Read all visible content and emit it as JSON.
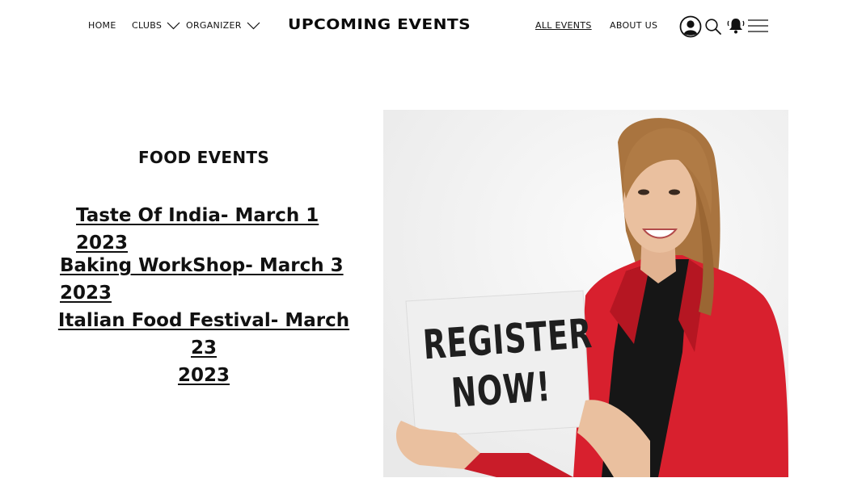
{
  "nav": {
    "home": "HOME",
    "clubs": "CLUBS",
    "organizer": "ORGANIZER",
    "all_events": "ALL EVENTS",
    "about_us": "ABOUT US"
  },
  "site_title": "UPCOMING EVENTS",
  "icons": [
    "user-icon",
    "search-icon",
    "bell-icon",
    "menu-icon",
    "chevron-down-icon"
  ],
  "content": {
    "section_heading": "FOOD EVENTS",
    "events": [
      "Taste Of India- March 1 2023",
      "Baking WorkShop- March 3 2023",
      "Italian Food Festival- March 23",
      "2023"
    ]
  },
  "hero": {
    "sign_line1": "REGISTER",
    "sign_line2": "NOW!",
    "jacket_color": "#d8202e"
  }
}
